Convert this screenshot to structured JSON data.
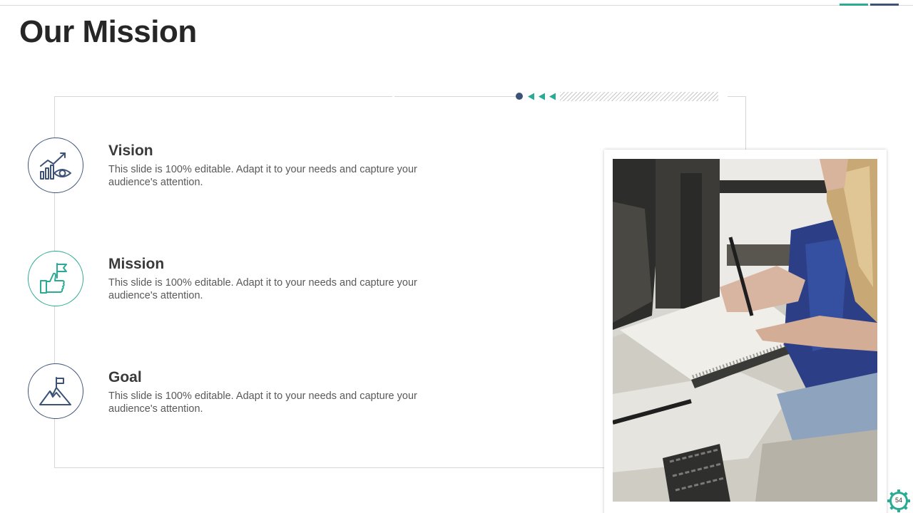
{
  "slide": {
    "title": "Our Mission",
    "page_number": "54"
  },
  "items": [
    {
      "title": "Vision",
      "description": "This slide is 100% editable.  Adapt it to your needs and capture your audience's attention.",
      "icon": "growth-chart-eye-icon"
    },
    {
      "title": "Mission",
      "description": "This slide is 100% editable.  Adapt it to your needs and capture your audience's attention.",
      "icon": "thumbs-up-flag-icon"
    },
    {
      "title": "Goal",
      "description": "This slide is 100% editable.  Adapt it to your needs and capture your audience's attention.",
      "icon": "mountain-flag-icon"
    }
  ],
  "photo": {
    "subject": "person-writing-in-notebook-photo"
  },
  "colors": {
    "navy": "#3c5377",
    "teal": "#2bab93",
    "title": "#262626",
    "text": "#595959"
  }
}
